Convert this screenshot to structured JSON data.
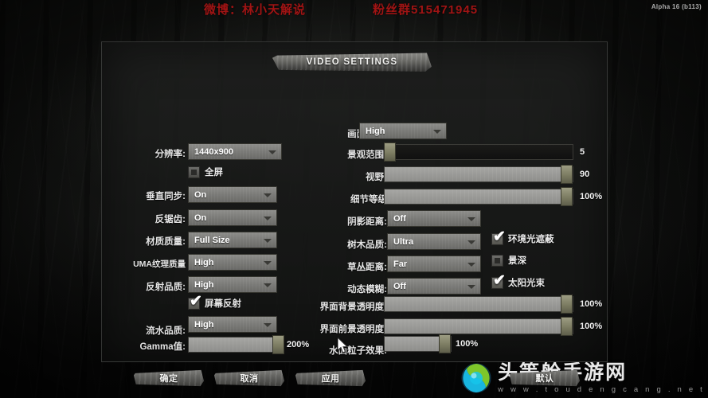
{
  "overlay": {
    "weibo_text": "微博：林小天解说",
    "qq_group_text": "粉丝群515471945",
    "version": "Alpha 16 (b113)",
    "watermark_cn": "头等舱手游网",
    "watermark_url": "w w w . t o u d e n g c a n g . n e t",
    "accent_red": "#a01414"
  },
  "panel": {
    "title": "VIDEO SETTINGS"
  },
  "left_column": {
    "resolution": {
      "label": "分辨率:",
      "value": "1440x900"
    },
    "fullscreen": {
      "label": "全屏",
      "checked": false
    },
    "vsync": {
      "label": "垂直同步:",
      "value": "On"
    },
    "antialiasing": {
      "label": "反锯齿:",
      "value": "On"
    },
    "texture_quality": {
      "label": "材质质量:",
      "value": "Full Size"
    },
    "uma_texture_quality": {
      "label": "UMA纹理质量",
      "value": "High"
    },
    "reflection_quality": {
      "label": "反射品质:",
      "value": "High"
    },
    "screen_reflection": {
      "label": "屏幕反射",
      "checked": true
    },
    "water_quality": {
      "label": "流水品质:",
      "value": "High"
    },
    "gamma": {
      "label": "Gamma值:",
      "value": "200%"
    }
  },
  "right_column": {
    "overall_quality": {
      "label": "画面质量:",
      "value": "High"
    },
    "view_distance": {
      "label": "景观范围:",
      "value": "5"
    },
    "field_of_view": {
      "label": "视野:",
      "value": "90"
    },
    "lod_level": {
      "label": "细节等级",
      "value": "100%"
    },
    "shadow_distance": {
      "label": "阴影距离:",
      "value": "Off"
    },
    "tree_quality": {
      "label": "树木品质:",
      "value": "Ultra"
    },
    "grass_distance": {
      "label": "草丛距离:",
      "value": "Far"
    },
    "motion_blur": {
      "label": "动态模糊:",
      "value": "Off"
    },
    "ui_background_opacity": {
      "label": "界面背景透明度:",
      "value": "100%"
    },
    "ui_foreground_opacity": {
      "label": "界面前景透明度:",
      "value": "100%"
    },
    "water_particle_effect": {
      "label": "水面粒子效果:",
      "value": "100%"
    }
  },
  "toggles": {
    "ambient_occlusion": {
      "label": "环境光遮蔽",
      "checked": true
    },
    "depth_of_field": {
      "label": "景深",
      "checked": false
    },
    "sun_shafts": {
      "label": "太阳光束",
      "checked": true
    }
  },
  "buttons": {
    "ok": "确定",
    "cancel": "取消",
    "apply": "应用",
    "default": "默认"
  }
}
